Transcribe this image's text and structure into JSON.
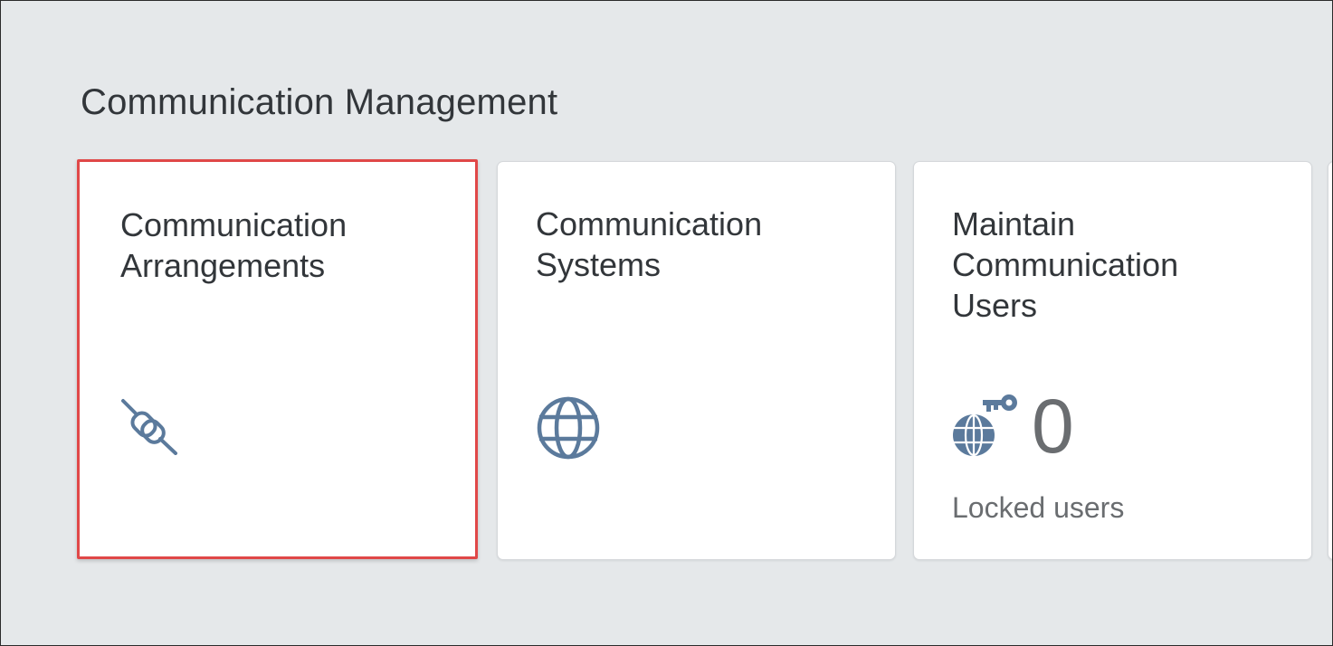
{
  "group": {
    "title": "Communication Management"
  },
  "tiles": [
    {
      "title_line1": "Communication",
      "title_line2": "Arrangements",
      "icon": "plug-disconnect-icon"
    },
    {
      "title_line1": "Communication",
      "title_line2": "Systems",
      "icon": "globe-icon"
    },
    {
      "title_line1": "Maintain",
      "title_line2": "Communication",
      "title_line3": "Users",
      "icon": "globe-key-icon",
      "kpi_value": "0",
      "kpi_footer": "Locked users"
    }
  ],
  "colors": {
    "background": "#e5e8ea",
    "tile": "#ffffff",
    "title_text": "#32363a",
    "icon": "#5b7a9c",
    "kpi_text": "#6a6d70",
    "selection_border": "#e04848"
  }
}
